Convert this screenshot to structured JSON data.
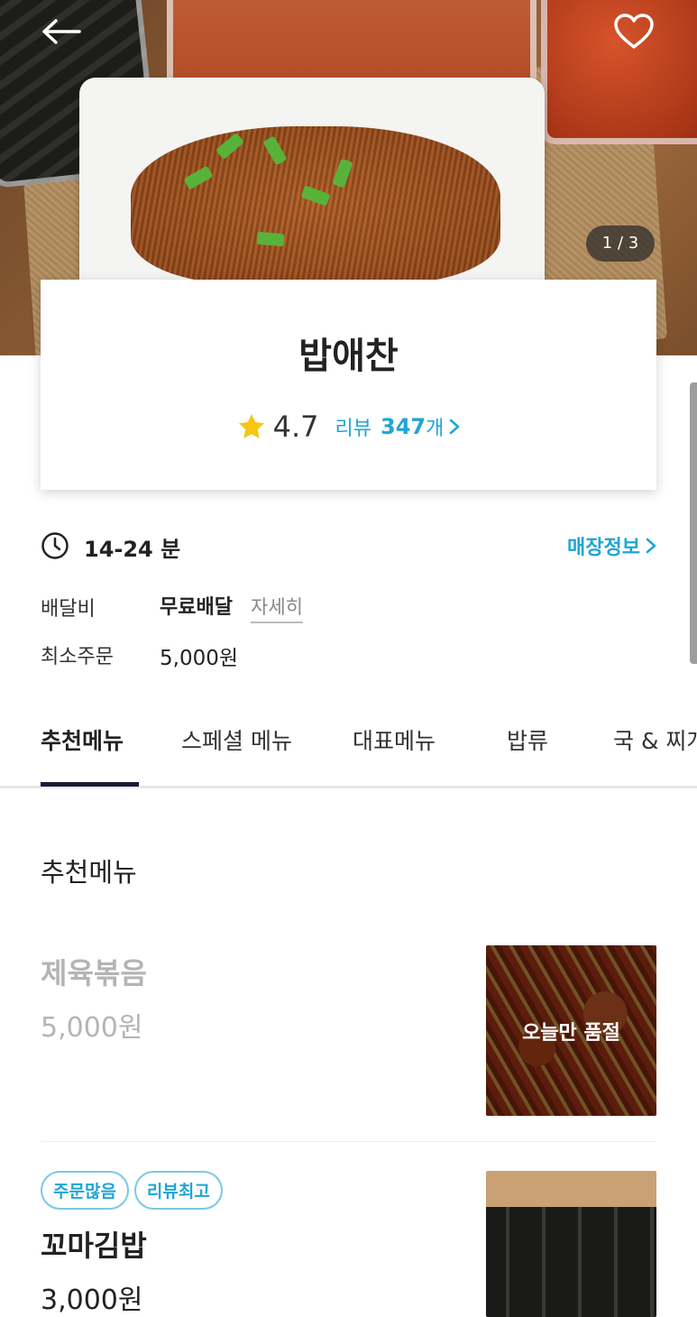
{
  "hero": {
    "pager_text": "1 / 3",
    "back_icon": "arrow-left-icon",
    "heart_icon": "heart-outline-icon"
  },
  "store": {
    "name": "밥애찬",
    "rating": "4.7",
    "review_label": "리뷰",
    "review_count": "347",
    "review_unit": "개"
  },
  "info": {
    "delivery_time": "14-24 분",
    "store_info_link": "매장정보",
    "fee_label": "배달비",
    "fee_value": "무료배달",
    "fee_detail": "자세히",
    "min_label": "최소주문",
    "min_value": "5,000원"
  },
  "tabs": [
    {
      "label": "추천메뉴",
      "active": true
    },
    {
      "label": "스페셜 메뉴"
    },
    {
      "label": "대표메뉴"
    },
    {
      "label": "밥류"
    },
    {
      "label": "국 & 찌개"
    }
  ],
  "menu": {
    "section_title": "추천메뉴",
    "items": [
      {
        "name": "제육볶음",
        "price": "5,000원",
        "soldout_label": "오늘만 품절"
      },
      {
        "name": "꼬마김밥",
        "price": "3,000원",
        "badges": [
          "주문많음",
          "리뷰최고"
        ]
      }
    ]
  },
  "colors": {
    "accent": "#1fa5d6",
    "tab_indicator": "#1b1b3a",
    "star": "#f7c613"
  }
}
